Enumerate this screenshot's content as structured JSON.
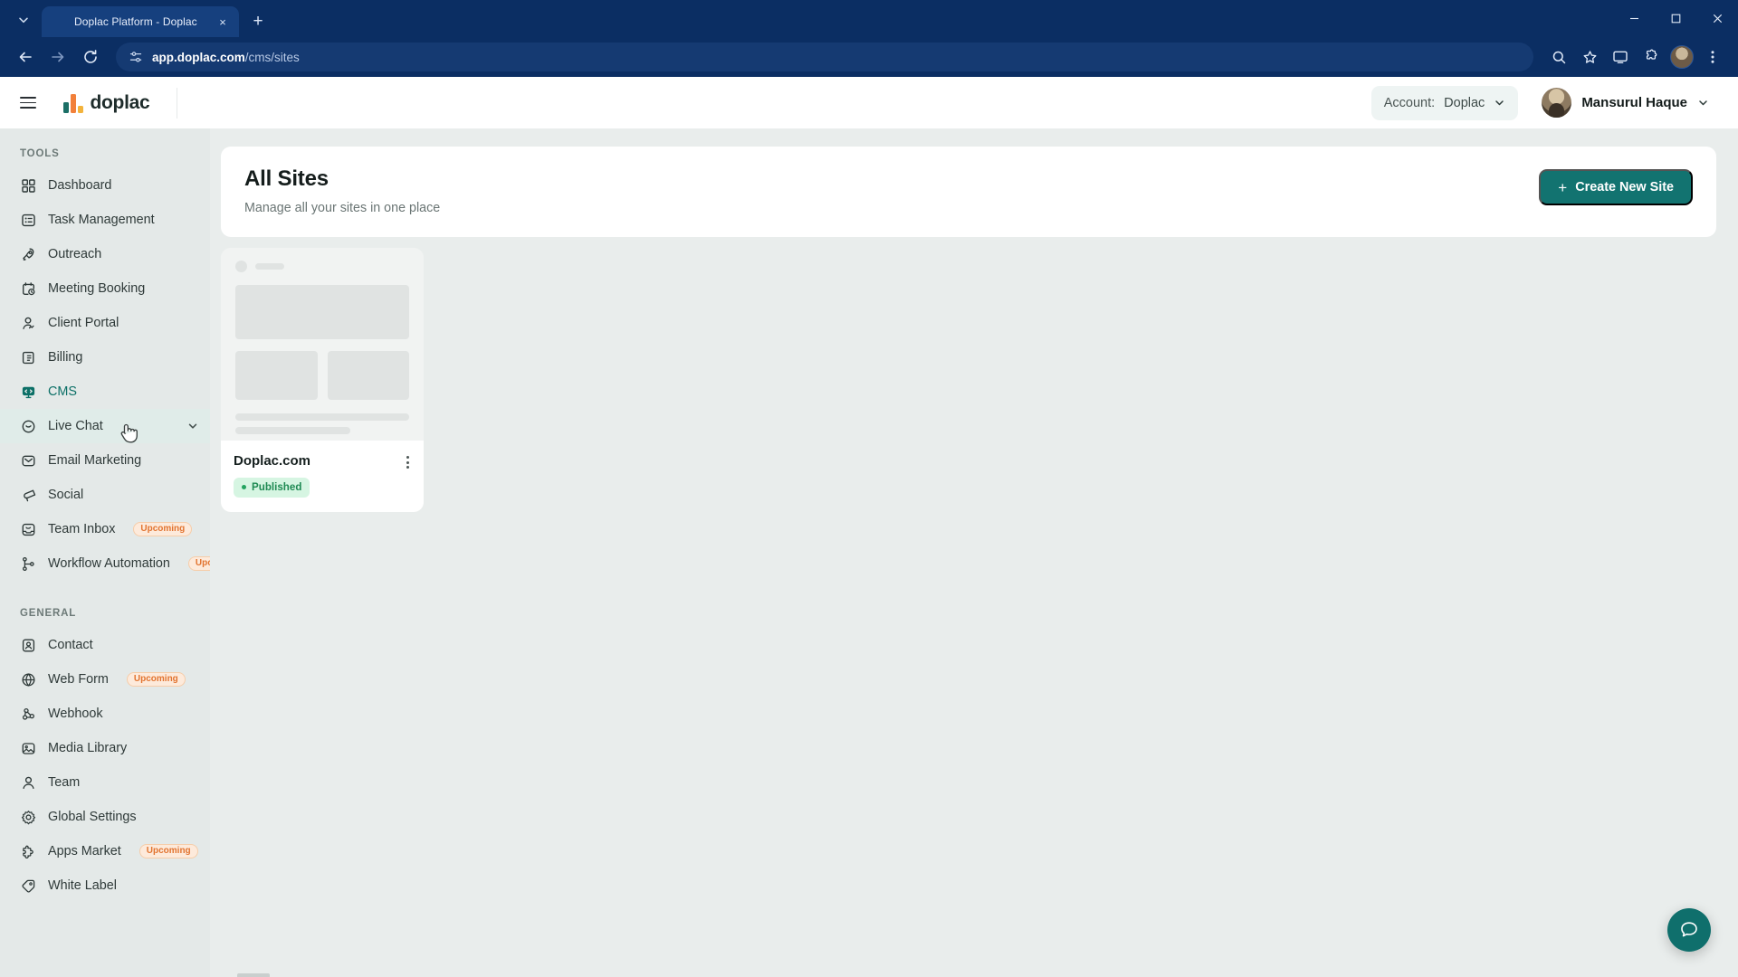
{
  "browser": {
    "tab": {
      "title": "Doplac Platform - Doplac",
      "favicon": "doplac-bars-icon",
      "close_label": "×"
    },
    "new_tab_label": "+",
    "tab_search_icon": "chevron-down-icon",
    "window": {
      "minimize": "─",
      "maximize": "☐",
      "close": "✕"
    },
    "nav": {
      "back_icon": "back-arrow-icon",
      "forward_icon": "forward-arrow-icon",
      "reload_icon": "reload-icon",
      "site_info_icon": "tune-icon"
    },
    "url": {
      "domain": "app.doplac.com",
      "path": "/cms/sites"
    },
    "toolbar": {
      "zoom_icon": "magnifier-icon",
      "bookmark_icon": "star-icon",
      "cast_icon": "screen-share-icon",
      "extensions_icon": "puzzle-icon",
      "profile_icon": "profile-avatar",
      "menu_icon": "kebab-menu-icon"
    }
  },
  "header": {
    "menu_icon": "hamburger-icon",
    "brand": "doplac",
    "account": {
      "prefix": "Account:",
      "name": "Doplac",
      "chevron": "chevron-down-icon"
    },
    "user": {
      "name": "Mansurul Haque",
      "chevron": "chevron-down-icon",
      "avatar": "user-avatar"
    }
  },
  "sidebar": {
    "sections": [
      {
        "label": "TOOLS",
        "items": [
          {
            "label": "Dashboard",
            "icon": "grid-icon",
            "state": "default"
          },
          {
            "label": "Task Management",
            "icon": "task-list-icon",
            "state": "default"
          },
          {
            "label": "Outreach",
            "icon": "rocket-icon",
            "state": "default"
          },
          {
            "label": "Meeting Booking",
            "icon": "calendar-clock-icon",
            "state": "default"
          },
          {
            "label": "Client Portal",
            "icon": "user-activity-icon",
            "state": "default"
          },
          {
            "label": "Billing",
            "icon": "invoice-icon",
            "state": "default"
          },
          {
            "label": "CMS",
            "icon": "cms-monitor-icon",
            "state": "active"
          },
          {
            "label": "Live Chat",
            "icon": "chat-smile-icon",
            "state": "hovered",
            "chevron": "chevron-down-icon"
          },
          {
            "label": "Email Marketing",
            "icon": "envelope-icon",
            "state": "default"
          },
          {
            "label": "Social",
            "icon": "megaphone-icon",
            "state": "default"
          },
          {
            "label": "Team Inbox",
            "icon": "inbox-smile-icon",
            "state": "default",
            "badge": "Upcoming"
          },
          {
            "label": "Workflow Automation",
            "icon": "workflow-nodes-icon",
            "state": "default",
            "badge": "Upcoming"
          }
        ]
      },
      {
        "label": "GENERAL",
        "items": [
          {
            "label": "Contact",
            "icon": "contact-card-icon",
            "state": "default"
          },
          {
            "label": "Web Form",
            "icon": "globe-icon",
            "state": "default",
            "badge": "Upcoming"
          },
          {
            "label": "Webhook",
            "icon": "webhook-icon",
            "state": "default"
          },
          {
            "label": "Media Library",
            "icon": "image-icon",
            "state": "default"
          },
          {
            "label": "Team",
            "icon": "person-icon",
            "state": "default"
          },
          {
            "label": "Global Settings",
            "icon": "gear-icon",
            "state": "default"
          },
          {
            "label": "Apps Market",
            "icon": "puzzle-piece-icon",
            "state": "default",
            "badge": "Upcoming"
          },
          {
            "label": "White Label",
            "icon": "tag-icon",
            "state": "default"
          }
        ]
      }
    ]
  },
  "main": {
    "title": "All Sites",
    "subtitle": "Manage all your sites in one place",
    "create_button": {
      "label": "Create New Site",
      "icon": "plus-icon"
    },
    "sites": [
      {
        "name": "Doplac.com",
        "status": "Published",
        "menu_icon": "kebab-menu-icon"
      }
    ]
  },
  "chat_widget": {
    "icon": "chat-bubble-icon"
  },
  "colors": {
    "accent_teal": "#127370",
    "browser_chrome": "#0b2e63",
    "sidebar_bg": "#e4e9e8",
    "badge_upcoming_text": "#e27430",
    "badge_upcoming_bg": "#fdeadb",
    "status_published_text": "#1f8a53",
    "status_published_bg": "#d6f5e2"
  }
}
